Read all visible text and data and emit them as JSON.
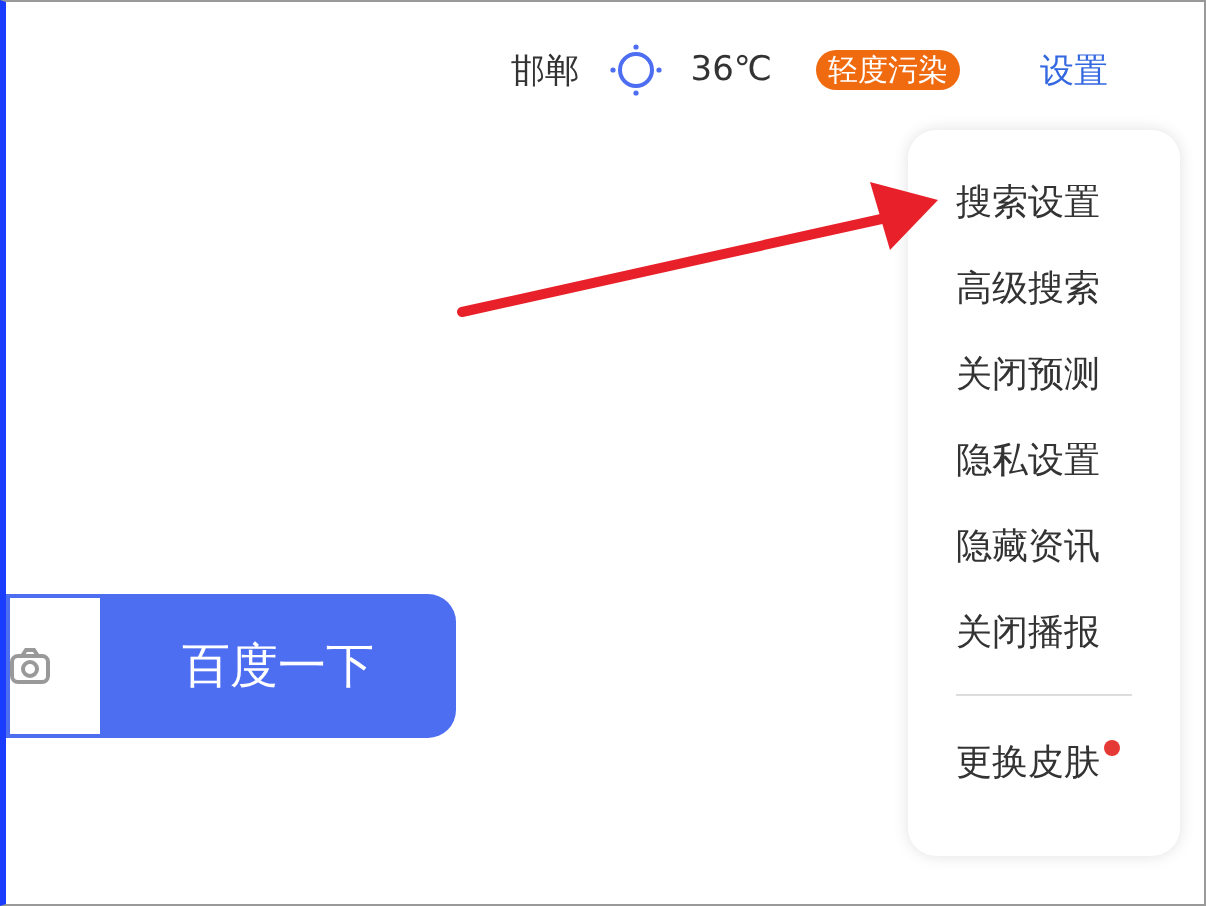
{
  "top_bar": {
    "city": "邯郸",
    "temperature": "36℃",
    "air_quality": "轻度污染",
    "settings": "设置"
  },
  "search": {
    "button": "百度一下"
  },
  "settings_menu": {
    "items": [
      {
        "label": "搜索设置",
        "dot": false
      },
      {
        "label": "高级搜索",
        "dot": false
      },
      {
        "label": "关闭预测",
        "dot": false
      },
      {
        "label": "隐私设置",
        "dot": false
      },
      {
        "label": "隐藏资讯",
        "dot": false
      },
      {
        "label": "关闭播报",
        "dot": false
      },
      {
        "label": "更换皮肤",
        "dot": true,
        "divider_before": true
      }
    ]
  }
}
